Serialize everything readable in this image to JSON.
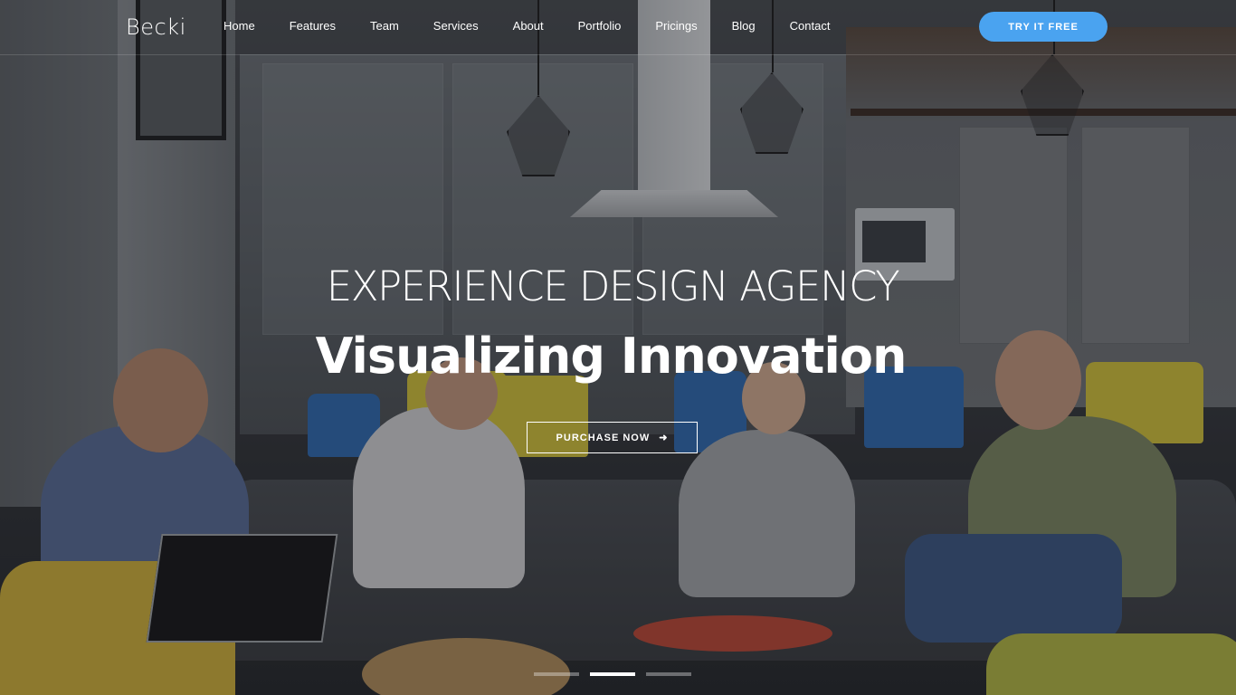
{
  "brand": {
    "logo": "Becki"
  },
  "nav": {
    "items": [
      "Home",
      "Features",
      "Team",
      "Services",
      "About",
      "Portfolio",
      "Pricings",
      "Blog",
      "Contact"
    ],
    "cta_label": "TRY IT FREE",
    "cta_color": "#4aa3f0"
  },
  "hero": {
    "eyebrow": "EXPERIENCE DESIGN AGENCY",
    "headline": "Visualizing Innovation",
    "button_label": "PURCHASE NOW",
    "button_icon": "arrow-right-icon",
    "background": "photo of people talking on a sofa in an office lounge"
  },
  "slider": {
    "slides": 3,
    "active_index": 1
  }
}
